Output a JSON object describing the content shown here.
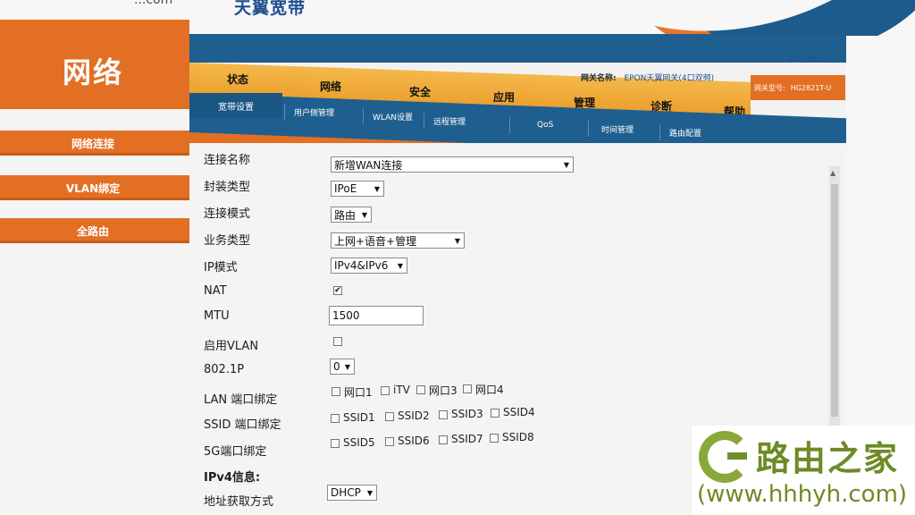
{
  "banner": {
    "brand_left": "...com",
    "brand": "天翼宽带"
  },
  "left": {
    "title": "网络",
    "items": [
      {
        "label": "网络连接"
      },
      {
        "label": "VLAN绑定"
      },
      {
        "label": "全路由"
      }
    ]
  },
  "header": {
    "top_links": "首页 | 退出",
    "gateway_name_label": "网关名称:",
    "gateway_name": "EPON天翼网关(4口双频)",
    "model_label": "网关型号:",
    "model": "HG2821T-U"
  },
  "menu": [
    "状态",
    "网络",
    "安全",
    "应用",
    "管理",
    "诊断",
    "帮助"
  ],
  "submenu": [
    "宽带设置",
    "用户侧管理",
    "WLAN设置",
    "远程管理",
    "QoS",
    "时间管理",
    "路由配置"
  ],
  "form": {
    "conn_name": {
      "label": "连接名称",
      "value": "新增WAN连接"
    },
    "encap": {
      "label": "封装类型",
      "value": "IPoE"
    },
    "mode": {
      "label": "连接模式",
      "value": "路由"
    },
    "service": {
      "label": "业务类型",
      "value": "上网+语音+管理"
    },
    "ipmode": {
      "label": "IP模式",
      "value": "IPv4&IPv6"
    },
    "nat": {
      "label": "NAT",
      "checked": true
    },
    "mtu": {
      "label": "MTU",
      "value": "1500"
    },
    "vlan": {
      "label": "启用VLAN",
      "checked": false
    },
    "p8021": {
      "label": "802.1P",
      "value": "0"
    },
    "lan_bind": {
      "label": "LAN 端口绑定",
      "options": [
        "网口1",
        "iTV",
        "网口3",
        "网口4"
      ]
    },
    "ssid_bind": {
      "label": "SSID 端口绑定",
      "options": [
        "SSID1",
        "SSID2",
        "SSID3",
        "SSID4"
      ]
    },
    "g5_bind": {
      "label": "5G端口绑定",
      "options": [
        "SSID5",
        "SSID6",
        "SSID7",
        "SSID8"
      ]
    },
    "ipv4_heading": "IPv4信息:",
    "addr": {
      "label": "地址获取方式",
      "value": "DHCP"
    }
  },
  "watermark": {
    "title": "路由之家",
    "url": "(www.hhhyh.com)"
  },
  "colors": {
    "orange": "#e36f24",
    "blue": "#1f5f8f",
    "gold": "#f0aa36"
  }
}
